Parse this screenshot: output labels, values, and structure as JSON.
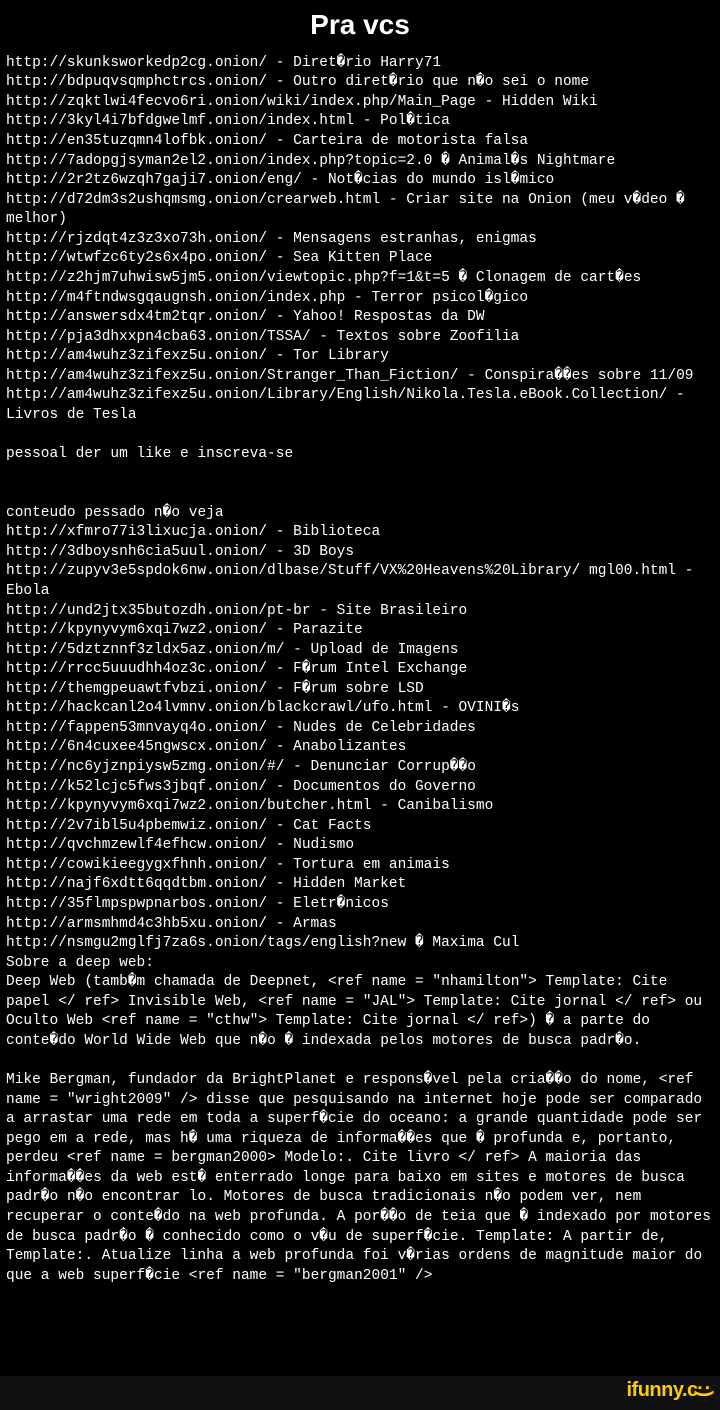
{
  "title": "Pra vcs",
  "body": "http://skunksworkedp2cg.onion/ - Diret�rio Harry71\nhttp://bdpuqvsqmphctrcs.onion/ - Outro diret�rio que n�o sei o nome\nhttp://zqktlwi4fecvo6ri.onion/wiki/index.php/Main_Page - Hidden Wiki\nhttp://3kyl4i7bfdgwelmf.onion/index.html - Pol�tica\nhttp://en35tuzqmn4lofbk.onion/ - Carteira de motorista falsa\nhttp://7adopgjsyman2el2.onion/index.php?topic=2.0 � Animal�s Nightmare http://2r2tz6wzqh7gaji7.onion/eng/ - Not�cias do mundo isl�mico\nhttp://d72dm3s2ushqmsmg.onion/crearweb.html - Criar site na Onion (meu v�deo � melhor)\nhttp://rjzdqt4z3z3xo73h.onion/ - Mensagens estranhas, enigmas\nhttp://wtwfzc6ty2s6x4po.onion/ - Sea Kitten Place\nhttp://z2hjm7uhwisw5jm5.onion/viewtopic.php?f=1&t=5 � Clonagem de cart�es\nhttp://m4ftndwsgqaugnsh.onion/index.php - Terror psicol�gico\nhttp://answersdx4tm2tqr.onion/ - Yahoo! Respostas da DW\nhttp://pja3dhxxpn4cba63.onion/TSSA/ - Textos sobre Zoofilia\nhttp://am4wuhz3zifexz5u.onion/ - Tor Library\nhttp://am4wuhz3zifexz5u.onion/Stranger_Than_Fiction/ - Conspira��es sobre 11/09\nhttp://am4wuhz3zifexz5u.onion/Library/English/Nikola.Tesla.eBook.Collection/ - Livros de Tesla\n\npessoal der um like e inscreva-se\n\n\nconteudo pessado n�o veja\nhttp://xfmro77i3lixucja.onion/ - Biblioteca\nhttp://3dboysnh6cia5uul.onion/ - 3D Boys\nhttp://zupyv3e5spdok6nw.onion/dlbase/Stuff/VX%20Heavens%20Library/ mgl00.html - Ebola\nhttp://und2jtx35butozdh.onion/pt-br - Site Brasileiro\nhttp://kpynyvym6xqi7wz2.onion/ - Parazite\nhttp://5dztznnf3zldx5az.onion/m/ - Upload de Imagens\nhttp://rrcc5uuudhh4oz3c.onion/ - F�rum Intel Exchange\nhttp://themgpeuawtfvbzi.onion/ - F�rum sobre LSD\nhttp://hackcanl2o4lvmnv.onion/blackcrawl/ufo.html - OVINI�s\nhttp://fappen53mnvayq4o.onion/ - Nudes de Celebridades\nhttp://6n4cuxee45ngwscx.onion/ - Anabolizantes\nhttp://nc6yjznpiysw5zmg.onion/#/ - Denunciar Corrup��o\nhttp://k52lcjc5fws3jbqf.onion/ - Documentos do Governo\nhttp://kpynyvym6xqi7wz2.onion/butcher.html - Canibalismo\nhttp://2v7ibl5u4pbemwiz.onion/ - Cat Facts\nhttp://qvchmzewlf4efhcw.onion/ - Nudismo\nhttp://cowikieegygxfhnh.onion/ - Tortura em animais\nhttp://najf6xdtt6qqdtbm.onion/ - Hidden Market\nhttp://35flmpspwpnarbos.onion/ - Eletr�nicos\nhttp://armsmhmd4c3hb5xu.onion/ - Armas\nhttp://nsmgu2mglfj7za6s.onion/tags/english?new � Maxima Cul\nSobre a deep web:\nDeep Web (tamb�m chamada de Deepnet, <ref name = \"nhamilton\"> Template: Cite papel </ ref> Invisible Web, <ref name = \"JAL\"> Template: Cite jornal </ ref> ou Oculto Web <ref name = \"cthw\"> Template: Cite jornal </ ref>) � a parte do conte�do World Wide Web que n�o � indexada pelos motores de busca padr�o.\n\nMike Bergman, fundador da BrightPlanet e respons�vel pela cria��o do nome, <ref name = \"wright2009\" /> disse que pesquisando na internet hoje pode ser comparado a arrastar uma rede em toda a superf�cie do oceano: a grande quantidade pode ser pego em a rede, mas h� uma riqueza de informa��es que � profunda e, portanto, perdeu <ref name = bergman2000> Modelo:. Cite livro </ ref> A maioria das informa��es da web est� enterrado longe para baixo em sites e motores de busca padr�o n�o encontrar lo. Motores de busca tradicionais n�o podem ver, nem recuperar o conte�do na web profunda. A por��o de teia que � indexado por motores de busca padr�o � conhecido como o v�u de superf�cie. Template: A partir de, Template:. Atualize linha a web profunda foi v�rias ordens de magnitude maior do que a web superf�cie <ref name = \"bergman2001\" />",
  "watermark": "ifunny.c"
}
